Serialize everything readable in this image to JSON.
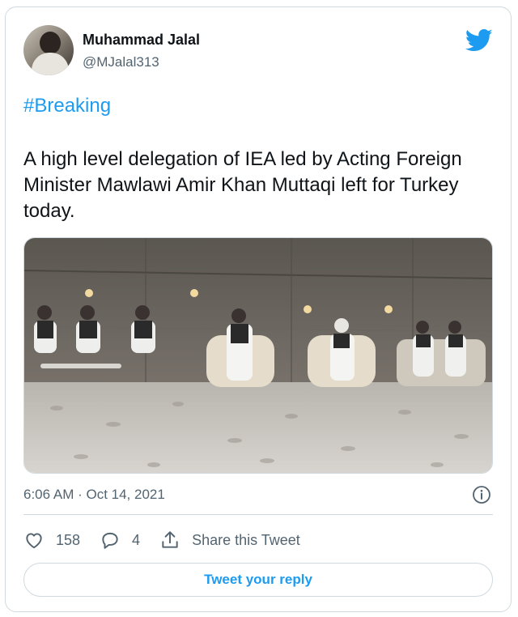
{
  "tweet": {
    "author_name": "Muhammad Jalal",
    "author_handle": "@MJalal313",
    "hashtag": "#Breaking",
    "text": "A high level delegation of IEA led by Acting Foreign Minister Mawlawi Amir Khan Muttaqi left for Turkey today.",
    "timestamp": "6:06 AM · Oct 14, 2021"
  },
  "actions": {
    "like_count": "158",
    "reply_count": "4",
    "share_label": "Share this Tweet",
    "reply_button_label": "Tweet your reply"
  },
  "colors": {
    "accent": "#1d9bf0",
    "text": "#0f1419",
    "secondary_text": "#536471",
    "border": "#cfd9de"
  },
  "icons": [
    "twitter-bird-icon",
    "info-icon",
    "heart-icon",
    "reply-bubble-icon",
    "share-icon"
  ]
}
